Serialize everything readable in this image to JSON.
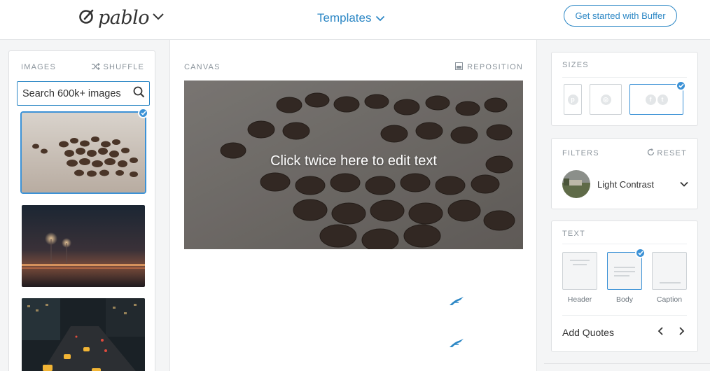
{
  "header": {
    "logo_text": "pablo",
    "templates_label": "Templates",
    "cta_label": "Get started with Buffer"
  },
  "images_panel": {
    "title": "IMAGES",
    "shuffle_label": "SHUFFLE",
    "search_placeholder": "Search 600k+ images"
  },
  "canvas_panel": {
    "title": "CANVAS",
    "reposition_label": "REPOSITION",
    "overlay_text": "Click twice here to edit text"
  },
  "sizes_panel": {
    "title": "SIZES",
    "options": [
      {
        "icon": "pinterest-icon",
        "selected": false
      },
      {
        "icon": "instagram-icon",
        "selected": false
      },
      {
        "icon": "facebook-twitter-icon",
        "selected": true
      }
    ]
  },
  "filters_panel": {
    "title": "FILTERS",
    "reset_label": "RESET",
    "current_filter": "Light Contrast"
  },
  "text_panel": {
    "title": "TEXT",
    "options": [
      {
        "label": "Header",
        "selected": false
      },
      {
        "label": "Body",
        "selected": true
      },
      {
        "label": "Caption",
        "selected": false
      }
    ],
    "quotes_label": "Add Quotes"
  },
  "colors": {
    "accent": "#2c87c5",
    "check": "#3c92d6"
  }
}
